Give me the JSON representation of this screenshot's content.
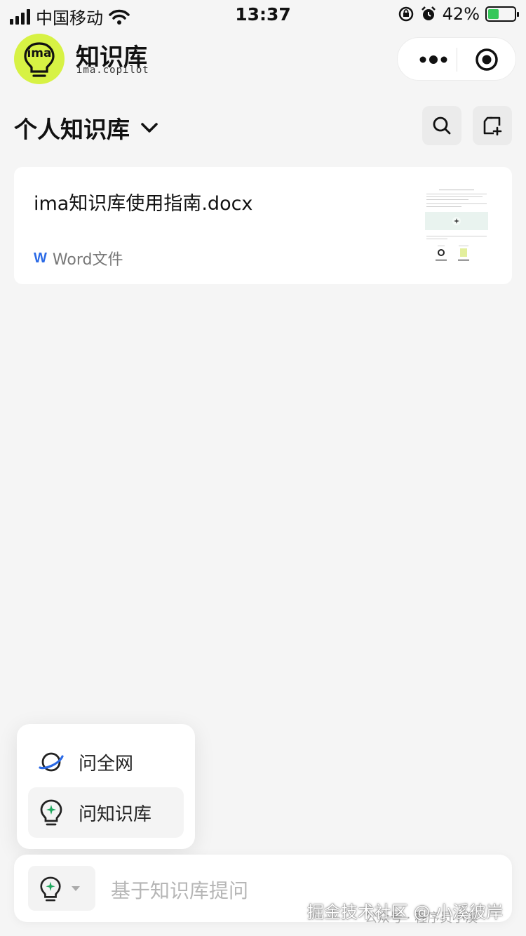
{
  "status_bar": {
    "carrier": "中国移动",
    "time": "13:37",
    "battery": "42%",
    "battery_level": 0.42
  },
  "header": {
    "logo_text": "ima",
    "title": "知识库",
    "subtitle": "ima.copilot"
  },
  "kb": {
    "title": "个人知识库"
  },
  "documents": [
    {
      "name": "ima知识库使用指南.docx",
      "type_label": "Word文件",
      "type_icon": "W"
    }
  ],
  "menu": {
    "items": [
      {
        "label": "问全网",
        "icon": "planet-icon",
        "selected": false
      },
      {
        "label": "问知识库",
        "icon": "bulb-star-icon",
        "selected": true
      }
    ]
  },
  "input": {
    "placeholder": "基于知识库提问"
  },
  "watermark": {
    "main": "掘金技术社区 @ 小溪彼岸",
    "sub": "公众号 · 程序员小溪"
  },
  "colors": {
    "brand": "#d7f244",
    "accent_green": "#1fa85e",
    "word_blue": "#2b6ae6"
  }
}
